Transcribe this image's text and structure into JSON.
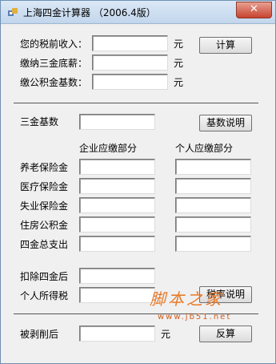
{
  "window": {
    "title": "上海四金计算器 （2006.4版）",
    "close_glyph": "✕"
  },
  "top_section": {
    "rows": [
      {
        "label": "您的税前收入：",
        "value": "",
        "unit": "元"
      },
      {
        "label": "缴纳三金底薪：",
        "value": "",
        "unit": "元"
      },
      {
        "label": "缴公积金基数：",
        "value": "",
        "unit": "元"
      }
    ],
    "calc_button": "计算"
  },
  "base_section": {
    "label": "三金基数",
    "value": "",
    "explain_button": "基数说明"
  },
  "columns": {
    "company": "企业应缴部分",
    "personal": "个人应缴部分"
  },
  "rows": [
    {
      "label": "养老保险金",
      "company": "",
      "personal": ""
    },
    {
      "label": "医疗保险金",
      "company": "",
      "personal": ""
    },
    {
      "label": "失业保险金",
      "company": "",
      "personal": ""
    },
    {
      "label": "住房公积金",
      "company": "",
      "personal": ""
    },
    {
      "label": "四金总支出",
      "company": "",
      "personal": ""
    }
  ],
  "after_section": {
    "after_deduct_label": "扣除四金后",
    "after_deduct_value": "",
    "income_tax_label": "个人所得税",
    "income_tax_value": "",
    "tax_rate_button": "税率说明"
  },
  "bottom_section": {
    "label": "被剥削后",
    "value": "",
    "unit": "元",
    "reverse_button": "反算"
  },
  "watermark": {
    "text": "脚本之家",
    "url": "www.jb51.net"
  }
}
